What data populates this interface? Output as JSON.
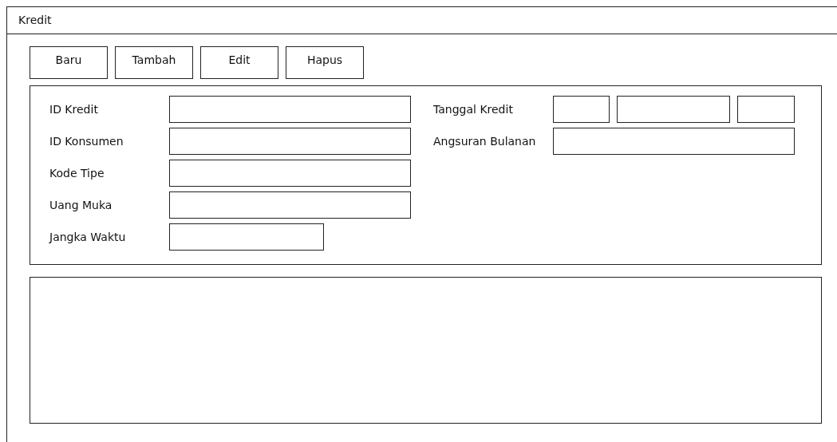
{
  "window": {
    "title": "Kredit"
  },
  "buttons": [
    "Baru",
    "Tambah",
    "Edit",
    "Hapus"
  ],
  "left_fields": [
    {
      "label": "ID Kredit",
      "kind": "text"
    },
    {
      "label": "ID Konsumen",
      "kind": "text"
    },
    {
      "label": "Kode Tipe",
      "kind": "text"
    },
    {
      "label": "Uang Muka",
      "kind": "text"
    },
    {
      "label": "Jangka Waktu",
      "kind": "short"
    }
  ],
  "right_fields": [
    {
      "label": "Tanggal Kredit",
      "kind": "date"
    },
    {
      "label": "Angsuran Bulanan",
      "kind": "text"
    }
  ]
}
